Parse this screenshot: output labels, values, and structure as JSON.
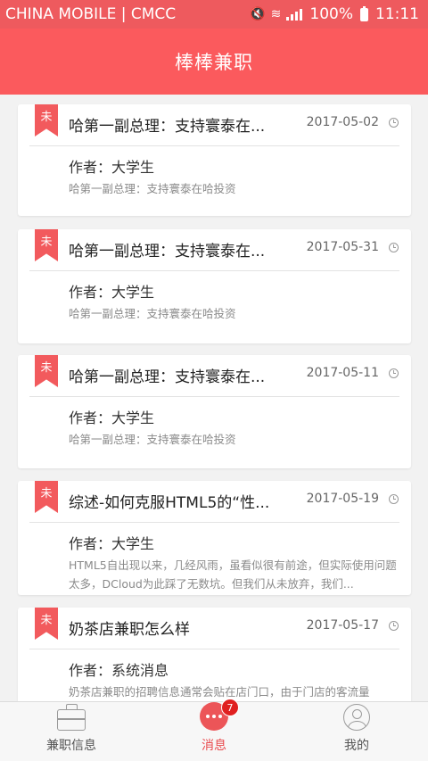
{
  "status": {
    "carrier": "CHINA MOBILE | CMCC",
    "battery": "100%",
    "time": "11:11"
  },
  "header": {
    "title": "棒棒兼职"
  },
  "cards": [
    {
      "ribbon": "未",
      "title": "哈第一副总理：支持寰泰在...",
      "date": "2017-05-02",
      "author": "作者：大学生",
      "desc": "哈第一副总理：支持寰泰在哈投资"
    },
    {
      "ribbon": "未",
      "title": "哈第一副总理：支持寰泰在...",
      "date": "2017-05-31",
      "author": "作者：大学生",
      "desc": "哈第一副总理：支持寰泰在哈投资"
    },
    {
      "ribbon": "未",
      "title": "哈第一副总理：支持寰泰在...",
      "date": "2017-05-11",
      "author": "作者：大学生",
      "desc": "哈第一副总理：支持寰泰在哈投资"
    },
    {
      "ribbon": "未",
      "title": "综述-如何克服HTML5的“性...",
      "date": "2017-05-19",
      "author": "作者：大学生",
      "desc": "HTML5自出现以来，几经风雨，虽看似很有前途，但实际使用问题太多，DCloud为此踩了无数坑。但我们从未放弃，我们..."
    },
    {
      "ribbon": "未",
      "title": "奶茶店兼职怎么样",
      "date": "2017-05-17",
      "author": "作者：系统消息",
      "desc": "奶茶店兼职的招聘信息通常会贴在店门口，由于门店的客流量"
    }
  ],
  "tabs": [
    {
      "label": "兼职信息",
      "icon": "briefcase-icon"
    },
    {
      "label": "消息",
      "icon": "message-icon",
      "badge": "7"
    },
    {
      "label": "我的",
      "icon": "user-icon"
    }
  ],
  "colors": {
    "accent": "#fb5a5d",
    "badge": "#e02020"
  }
}
